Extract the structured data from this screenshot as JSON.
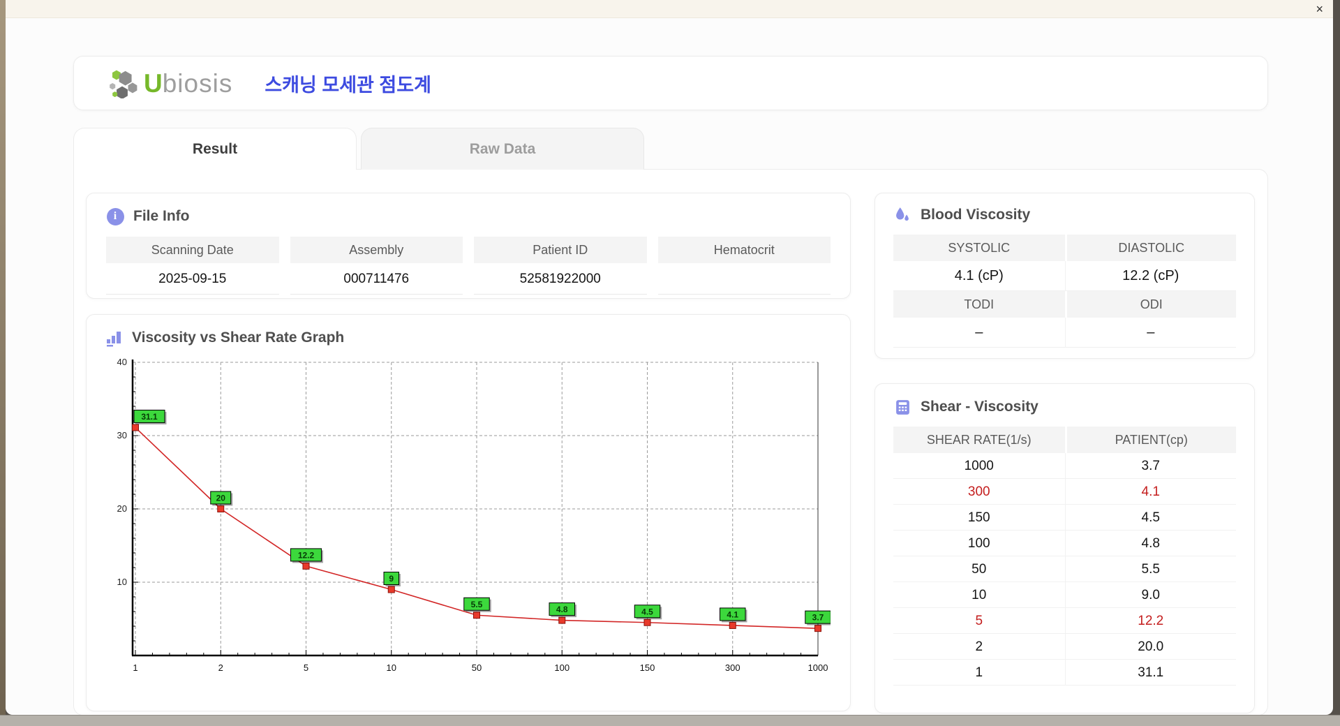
{
  "window": {
    "close_glyph": "×"
  },
  "header": {
    "brand": {
      "u": "U",
      "rest": "biosis"
    },
    "app_title": "스캐닝 모세관 점도계"
  },
  "tabs": {
    "result": "Result",
    "raw_data": "Raw Data"
  },
  "file_info": {
    "title": "File Info",
    "fields": [
      {
        "label": "Scanning Date",
        "value": "2025-09-15"
      },
      {
        "label": "Assembly",
        "value": "000711476"
      },
      {
        "label": "Patient ID",
        "value": "52581922000"
      },
      {
        "label": "Hematocrit",
        "value": ""
      }
    ]
  },
  "blood_viscosity": {
    "title": "Blood Viscosity",
    "sections": [
      {
        "cols": [
          {
            "label": "SYSTOLIC",
            "value": "4.1 (cP)"
          },
          {
            "label": "DIASTOLIC",
            "value": "12.2 (cP)"
          }
        ]
      },
      {
        "cols": [
          {
            "label": "TODI",
            "value": "–"
          },
          {
            "label": "ODI",
            "value": "–"
          }
        ]
      }
    ]
  },
  "shear_viscosity": {
    "title": "Shear - Viscosity",
    "columns": [
      "SHEAR RATE(1/s)",
      "PATIENT(cp)"
    ],
    "rows": [
      {
        "shear_rate": "1000",
        "patient": "3.7",
        "highlight": false
      },
      {
        "shear_rate": "300",
        "patient": "4.1",
        "highlight": true
      },
      {
        "shear_rate": "150",
        "patient": "4.5",
        "highlight": false
      },
      {
        "shear_rate": "100",
        "patient": "4.8",
        "highlight": false
      },
      {
        "shear_rate": "50",
        "patient": "5.5",
        "highlight": false
      },
      {
        "shear_rate": "10",
        "patient": "9.0",
        "highlight": false
      },
      {
        "shear_rate": "5",
        "patient": "12.2",
        "highlight": true
      },
      {
        "shear_rate": "2",
        "patient": "20.0",
        "highlight": false
      },
      {
        "shear_rate": "1",
        "patient": "31.1",
        "highlight": false
      }
    ]
  },
  "chart_data": {
    "type": "line",
    "title": "Viscosity vs Shear Rate Graph",
    "x_categories": [
      "1",
      "2",
      "5",
      "10",
      "50",
      "100",
      "150",
      "300",
      "1000"
    ],
    "values": [
      31.1,
      20,
      12.2,
      9,
      5.5,
      4.8,
      4.5,
      4.1,
      3.7
    ],
    "point_labels": [
      "31.1",
      "20",
      "12.2",
      "9",
      "5.5",
      "4.8",
      "4.5",
      "4.1",
      "3.7"
    ],
    "xlabel": "",
    "ylabel": "",
    "ylim": [
      0,
      40
    ],
    "yticks": [
      10,
      20,
      30,
      40
    ],
    "x_scale": "categorical-evenly-spaced-shear-rates",
    "grid": "dashed",
    "legend": false
  },
  "icons": {
    "window_close": "close-icon",
    "brand": "hexagon-cluster-logo",
    "file_info": "info-circle-icon",
    "graph": "bar-chart-icon",
    "blood_viscosity": "water-drops-icon",
    "shear_viscosity": "calculator-icon"
  },
  "colors": {
    "accent_purple": "#8a91e8",
    "app_title_blue": "#3d4be0",
    "brand_green": "#76b82a",
    "brand_gray": "#9e9e9e",
    "highlight_red": "#c41e1e",
    "chart_line": "#d22626",
    "chart_marker": "#e83a2b",
    "chart_marker_border": "#8b120b",
    "chart_label_bg": "#3cd83c"
  }
}
